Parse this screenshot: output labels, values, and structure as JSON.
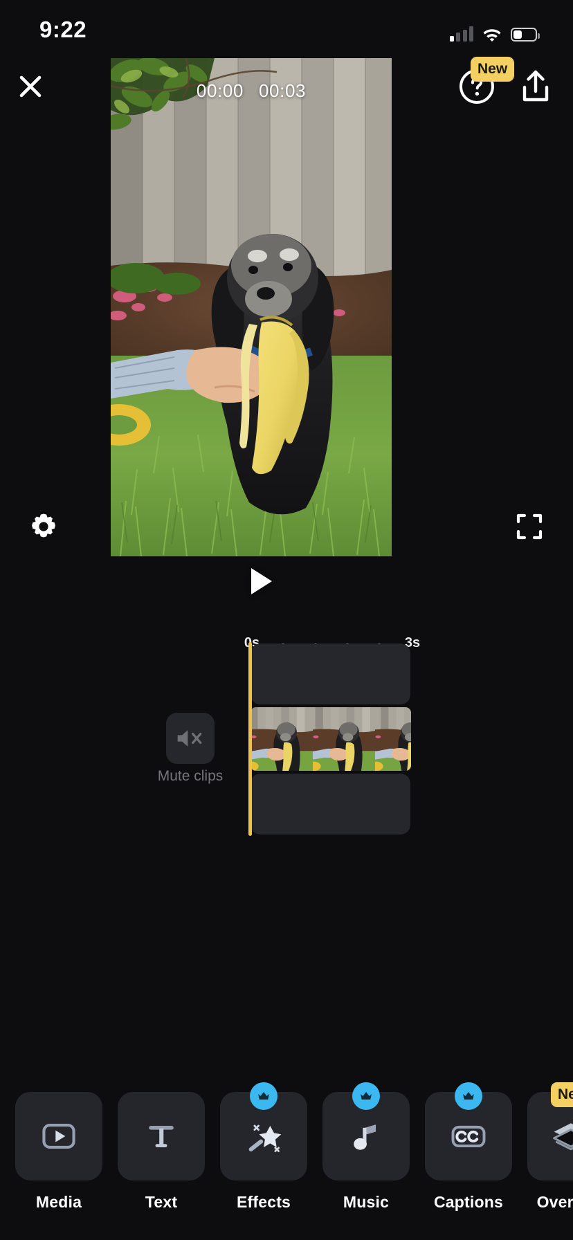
{
  "status_bar": {
    "time": "9:22",
    "cellular_icon": "signal-bars-icon",
    "cellular_bars_filled": 1,
    "wifi_icon": "wifi-icon",
    "battery_icon": "battery-icon",
    "battery_level_percent": 35
  },
  "header": {
    "close_icon": "close-icon",
    "help_icon": "help-question-icon",
    "help_badge": "New",
    "share_icon": "share-upload-icon"
  },
  "preview": {
    "current_time": "00:00",
    "total_time": "00:03",
    "play_icon": "play-icon",
    "settings_icon": "gear-icon",
    "fullscreen_icon": "fullscreen-expand-icon"
  },
  "ruler": {
    "start_label": "0s",
    "end_label": "3s",
    "ticks": [
      "0s",
      "",
      "",
      "",
      "",
      "3s"
    ]
  },
  "timeline": {
    "mute_icon": "speaker-mute-icon",
    "mute_label": "Mute clips",
    "playhead_color": "#f0c248",
    "track_color": "#25272d"
  },
  "toolbar": {
    "items": [
      {
        "label": "Media",
        "icon": "media-play-square-icon",
        "badge": null,
        "badge_type": null
      },
      {
        "label": "Text",
        "icon": "text-t-icon",
        "badge": null,
        "badge_type": null
      },
      {
        "label": "Effects",
        "icon": "magic-wand-icon",
        "badge": "crown",
        "badge_type": "pro"
      },
      {
        "label": "Music",
        "icon": "music-note-icon",
        "badge": "crown",
        "badge_type": "pro"
      },
      {
        "label": "Captions",
        "icon": "closed-caption-icon",
        "badge": "crown",
        "badge_type": "pro"
      },
      {
        "label": "Overlays",
        "icon": "layers-icon",
        "badge": "New",
        "badge_type": "new"
      }
    ]
  },
  "colors": {
    "background": "#0d0d0f",
    "tile": "#24262c",
    "accent_yellow": "#f4cf62",
    "accent_cyan": "#3cb8f0",
    "text_primary": "#ffffff",
    "text_muted": "#74767c"
  }
}
